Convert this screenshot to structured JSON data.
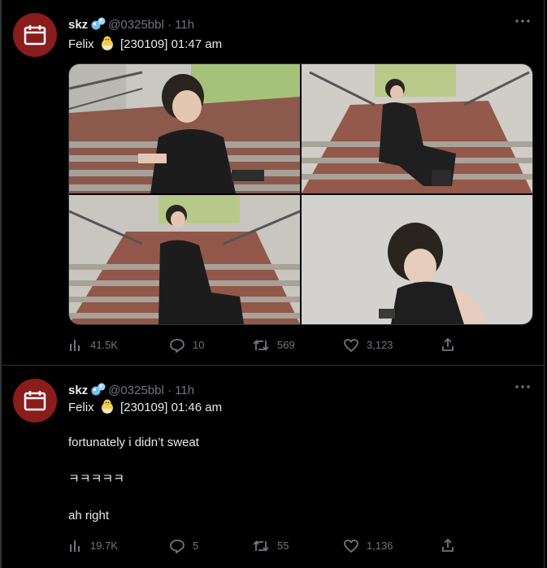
{
  "tweets": [
    {
      "author": {
        "name": "skz",
        "handle": "@0325bbl",
        "time": "11h"
      },
      "text": {
        "before_chick": "Felix",
        "after_chick": "[230109] 01:47 am"
      },
      "photos_count": 4,
      "stats": {
        "views": "41.5K",
        "replies": "10",
        "retweets": "569",
        "likes": "3,123"
      }
    },
    {
      "author": {
        "name": "skz",
        "handle": "@0325bbl",
        "time": "11h"
      },
      "text": {
        "before_chick": "Felix",
        "after_chick": "[230109] 01:46 am",
        "line2": "fortunately i didn’t sweat",
        "line3": "ㅋㅋㅋㅋㅋ",
        "line4": "ah right"
      },
      "stats": {
        "views": "19.7K",
        "replies": "5",
        "retweets": "55",
        "likes": "1,136"
      }
    }
  ],
  "colors": {
    "background": "#000000",
    "text": "#e7e9ea",
    "muted": "#71767b",
    "avatar": "#8b1c1c",
    "border": "#2f3336"
  },
  "icons": [
    "calendar-icon",
    "bubbles-icon",
    "chick-icon",
    "more-icon",
    "views-icon",
    "reply-icon",
    "retweet-icon",
    "like-icon",
    "share-icon"
  ]
}
